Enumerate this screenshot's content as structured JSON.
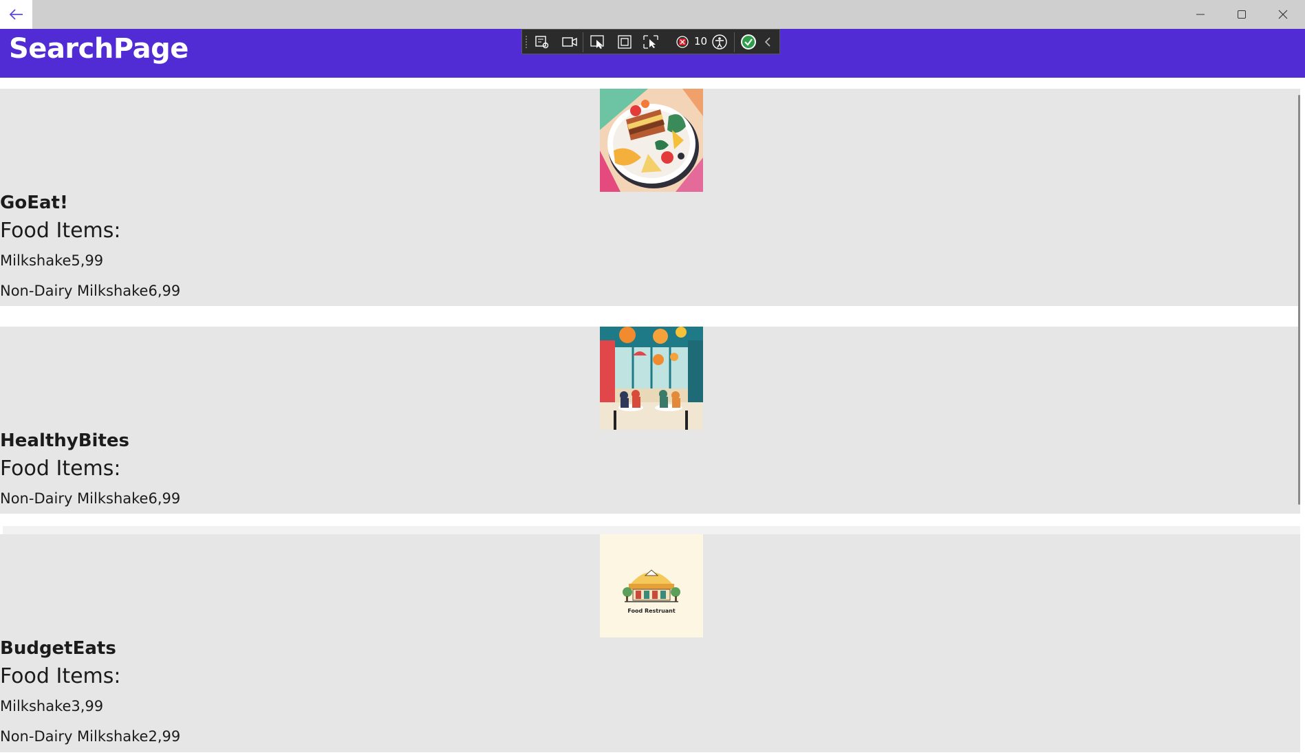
{
  "window": {
    "minimize_icon": "minimize-icon",
    "maximize_icon": "maximize-icon",
    "close_icon": "close-icon"
  },
  "header": {
    "title": "SearchPage",
    "background": "#512bd4"
  },
  "debug_toolbar": {
    "counter": "10"
  },
  "restaurants": [
    {
      "name": "GoEat!",
      "items_label": "Food Items:",
      "items": [
        "Milkshake5,99",
        "Non-Dairy Milkshake6,99"
      ]
    },
    {
      "name": "HealthyBites",
      "items_label": "Food Items:",
      "items": [
        "Non-Dairy Milkshake6,99"
      ]
    },
    {
      "name": "BudgetEats",
      "items_label": "Food Items:",
      "items": [
        "Milkshake3,99",
        "Non-Dairy Milkshake2,99"
      ],
      "logo_text": "Food Restruant"
    }
  ]
}
